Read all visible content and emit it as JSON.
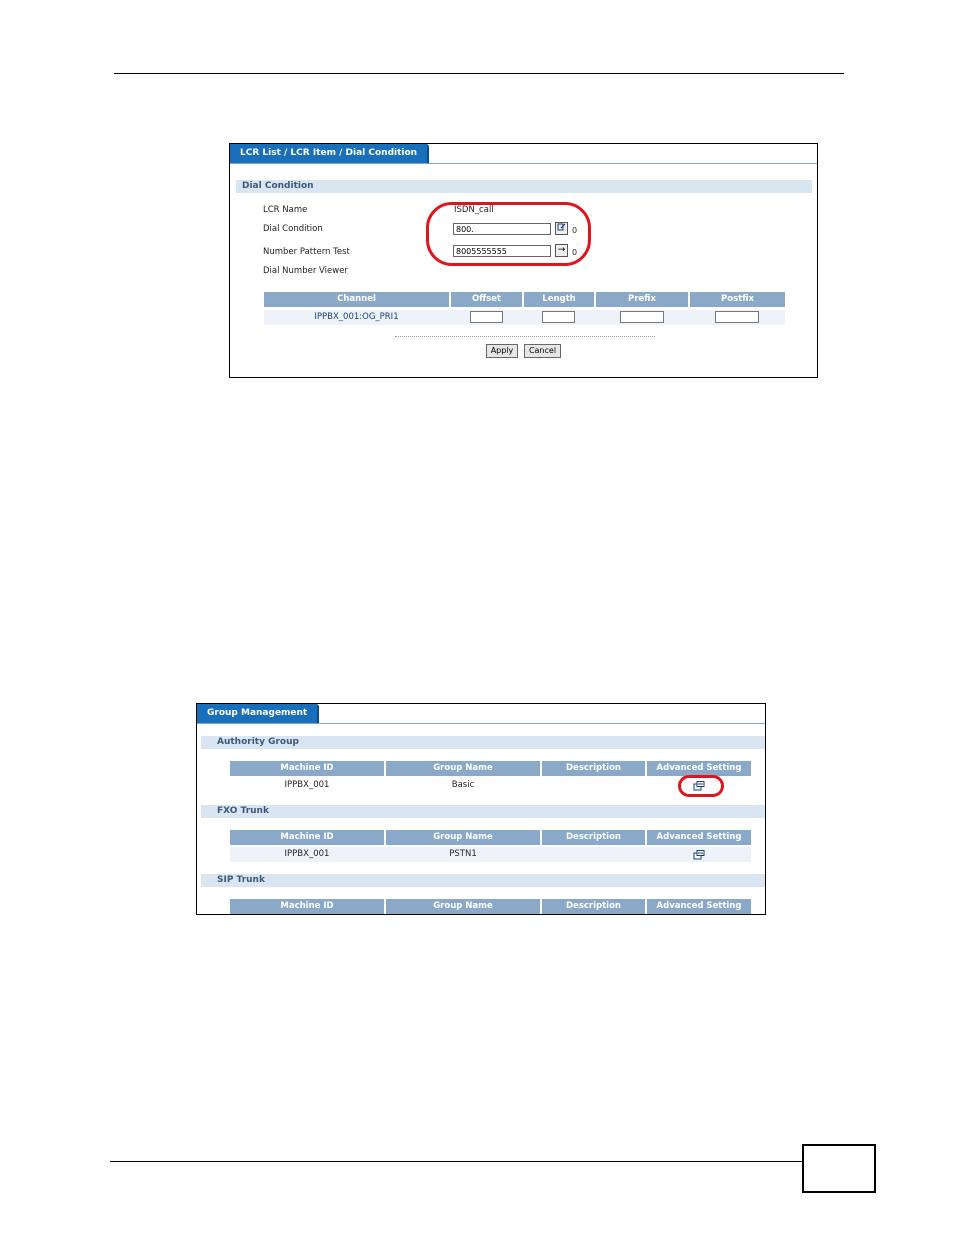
{
  "dial_condition_screen": {
    "tab_label": "LCR List / LCR Item / Dial Condition",
    "section_title": "Dial Condition",
    "fields": {
      "lcr_name_label": "LCR Name",
      "lcr_name_value": "ISDN_call",
      "dial_condition_label": "Dial Condition",
      "dial_condition_value": "800.",
      "number_pattern_label": "Number Pattern Test",
      "number_pattern_value": "8005555555",
      "dial_number_viewer_label": "Dial Number Viewer",
      "hint_a": "0",
      "hint_b": "0"
    },
    "table": {
      "headers": [
        "Channel",
        "Offset",
        "Length",
        "Prefix",
        "Postfix"
      ],
      "rows": [
        [
          "IPPBX_001:OG_PRI1",
          "",
          "",
          "",
          ""
        ]
      ]
    },
    "buttons": {
      "apply": "Apply",
      "cancel": "Cancel"
    }
  },
  "group_management_screen": {
    "tab_label": "Group Management",
    "sections": [
      {
        "title": "Authority Group",
        "headers": [
          "Machine ID",
          "Group Name",
          "Description",
          "Advanced Setting"
        ],
        "rows": [
          [
            "IPPBX_001",
            "Basic",
            "",
            "edit-icon"
          ]
        ]
      },
      {
        "title": "FXO Trunk",
        "headers": [
          "Machine ID",
          "Group Name",
          "Description",
          "Advanced Setting"
        ],
        "rows": [
          [
            "IPPBX_001",
            "PSTN1",
            "",
            "edit-icon"
          ]
        ]
      },
      {
        "title": "SIP Trunk",
        "headers": [
          "Machine ID",
          "Group Name",
          "Description",
          "Advanced Setting"
        ],
        "rows": []
      }
    ]
  },
  "colors": {
    "tab": "#1a6fbb",
    "header": "#8aa9c9",
    "section_bg": "#d9e6f2",
    "highlight": "#e0151b"
  }
}
